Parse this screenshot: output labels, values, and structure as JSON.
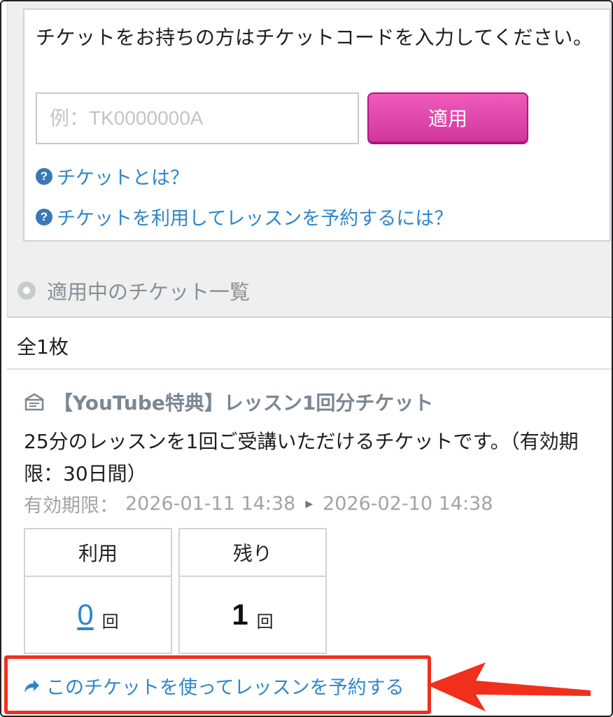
{
  "ticket_entry": {
    "prompt": "チケットをお持ちの方はチケットコードを入力してください。",
    "code_placeholder": "例：TK0000000A",
    "code_value": "",
    "apply_label": "適用",
    "help_links": [
      {
        "label": "チケットとは？"
      },
      {
        "label": "チケットを利用してレッスンを予約するには？"
      }
    ]
  },
  "applied_section": {
    "heading": "適用中のチケット一覧",
    "count": "全1枚"
  },
  "ticket": {
    "title": "【YouTube特典】レッスン1回分チケット",
    "description": "25分のレッスンを1回ご受講いただけるチケットです。（有効期限：30日間）",
    "validity_label": "有効期限：",
    "validity_start": "2026-01-11 14:38",
    "validity_end": "2026-02-10 14:38",
    "used_label": "利用",
    "used_count": "0",
    "remaining_label": "残り",
    "remaining_count": "1",
    "unit": "回",
    "reserve_link": "このチケットを使ってレッスンを予約する"
  },
  "colors": {
    "apply_button": "#d2379c",
    "link": "#2f86c9",
    "highlight": "#f0301c"
  },
  "icons": {
    "help": "question-circle-icon",
    "section_bullet": "radio-dot-icon",
    "ticket": "ticket-icon",
    "reserve": "share-arrow-icon",
    "annotation": "red-arrow-annotation"
  }
}
